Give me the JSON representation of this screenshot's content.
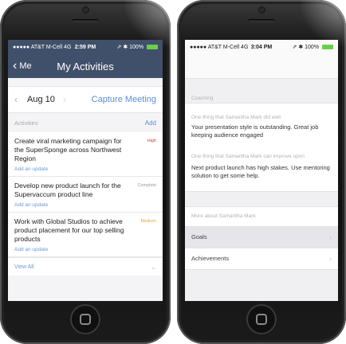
{
  "left": {
    "statusbar": {
      "carrier": "●●●●● AT&T M-Cell  4G",
      "time": "2:59 PM",
      "right": "⇗ ✱ 100%"
    },
    "navbar": {
      "back_label": "Me",
      "title": "My Activities"
    },
    "datebar": {
      "date": "Aug 10",
      "capture_label": "Capture Meeting"
    },
    "section": {
      "label": "Activities",
      "add_label": "Add"
    },
    "activities": [
      {
        "title": "Create viral marketing campaign for the SuperSponge across Northwest Region",
        "badge": "High",
        "badge_color": "#d23b3b",
        "update": "Add an update"
      },
      {
        "title": "Develop new product launch for the Supervaccum product line",
        "badge": "Complete",
        "badge_color": "#9a9a9a",
        "update": "Add an update"
      },
      {
        "title": "Work with Global Studios to achieve product placement for our top selling products",
        "badge": "Medium",
        "badge_color": "#e6a33a",
        "update": "Add an update"
      }
    ],
    "view_all_label": "View All"
  },
  "right": {
    "statusbar": {
      "carrier": "●●●●● AT&T M-Cell  4G",
      "time": "3:04 PM",
      "right": "⇗ ✱ 100%"
    },
    "coaching_label": "Coaching",
    "did_well_label": "One thing that Samantha Mark did well",
    "did_well_text": "Your presentation style is outstanding. Great job keeping audience engaged",
    "improve_label": "One thing that Samantha Mark can improve upon",
    "improve_text": "Next product launch has high stakes. Use mentoring solution to get some help.",
    "more_label": "More about Samantha Mark",
    "items": [
      {
        "label": "Goals"
      },
      {
        "label": "Achievements"
      }
    ]
  }
}
